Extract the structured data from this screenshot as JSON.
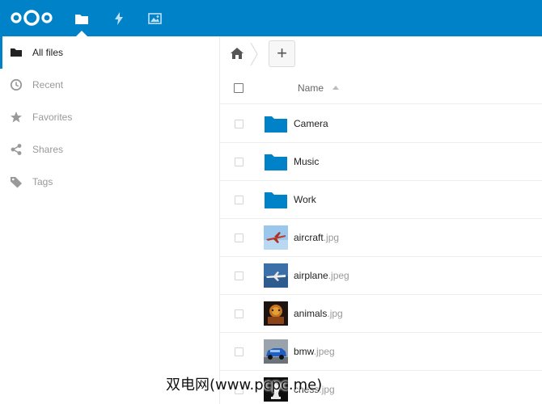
{
  "header": {
    "apps": [
      {
        "name": "files-icon"
      },
      {
        "name": "activity-icon"
      },
      {
        "name": "gallery-icon"
      }
    ],
    "accent": "#0082c9"
  },
  "sidebar": {
    "items": [
      {
        "label": "All files",
        "icon": "folder-icon",
        "active": true
      },
      {
        "label": "Recent",
        "icon": "clock-icon",
        "active": false
      },
      {
        "label": "Favorites",
        "icon": "star-icon",
        "active": false
      },
      {
        "label": "Shares",
        "icon": "share-icon",
        "active": false
      },
      {
        "label": "Tags",
        "icon": "tag-icon",
        "active": false
      }
    ]
  },
  "controls": {
    "new_label": "+"
  },
  "table": {
    "name_header": "Name",
    "rows": [
      {
        "base": "Camera",
        "ext": "",
        "type": "folder"
      },
      {
        "base": "Music",
        "ext": "",
        "type": "folder"
      },
      {
        "base": "Work",
        "ext": "",
        "type": "folder"
      },
      {
        "base": "aircraft",
        "ext": ".jpg",
        "type": "image"
      },
      {
        "base": "airplane",
        "ext": ".jpeg",
        "type": "image"
      },
      {
        "base": "animals",
        "ext": ".jpg",
        "type": "image"
      },
      {
        "base": "bmw",
        "ext": ".jpeg",
        "type": "image"
      },
      {
        "base": "chess",
        "ext": ".jpg",
        "type": "image"
      }
    ]
  },
  "watermark": "双电网(www.pcpc.me)"
}
